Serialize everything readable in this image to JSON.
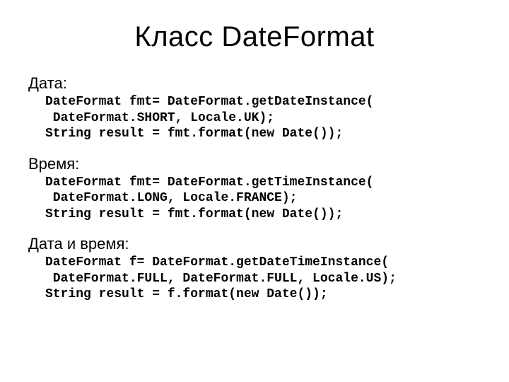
{
  "title": "Класс DateFormat",
  "sections": [
    {
      "label": "Дата:",
      "code": "DateFormat fmt= DateFormat.getDateInstance(\n DateFormat.SHORT, Locale.UK);\nString result = fmt.format(new Date());"
    },
    {
      "label": "Время:",
      "code": "DateFormat fmt= DateFormat.getTimeInstance(\n DateFormat.LONG, Locale.FRANCE);\nString result = fmt.format(new Date());"
    },
    {
      "label": "Дата и время:",
      "code": "DateFormat f= DateFormat.getDateTimeInstance(\n DateFormat.FULL, DateFormat.FULL, Locale.US);\nString result = f.format(new Date());"
    }
  ]
}
